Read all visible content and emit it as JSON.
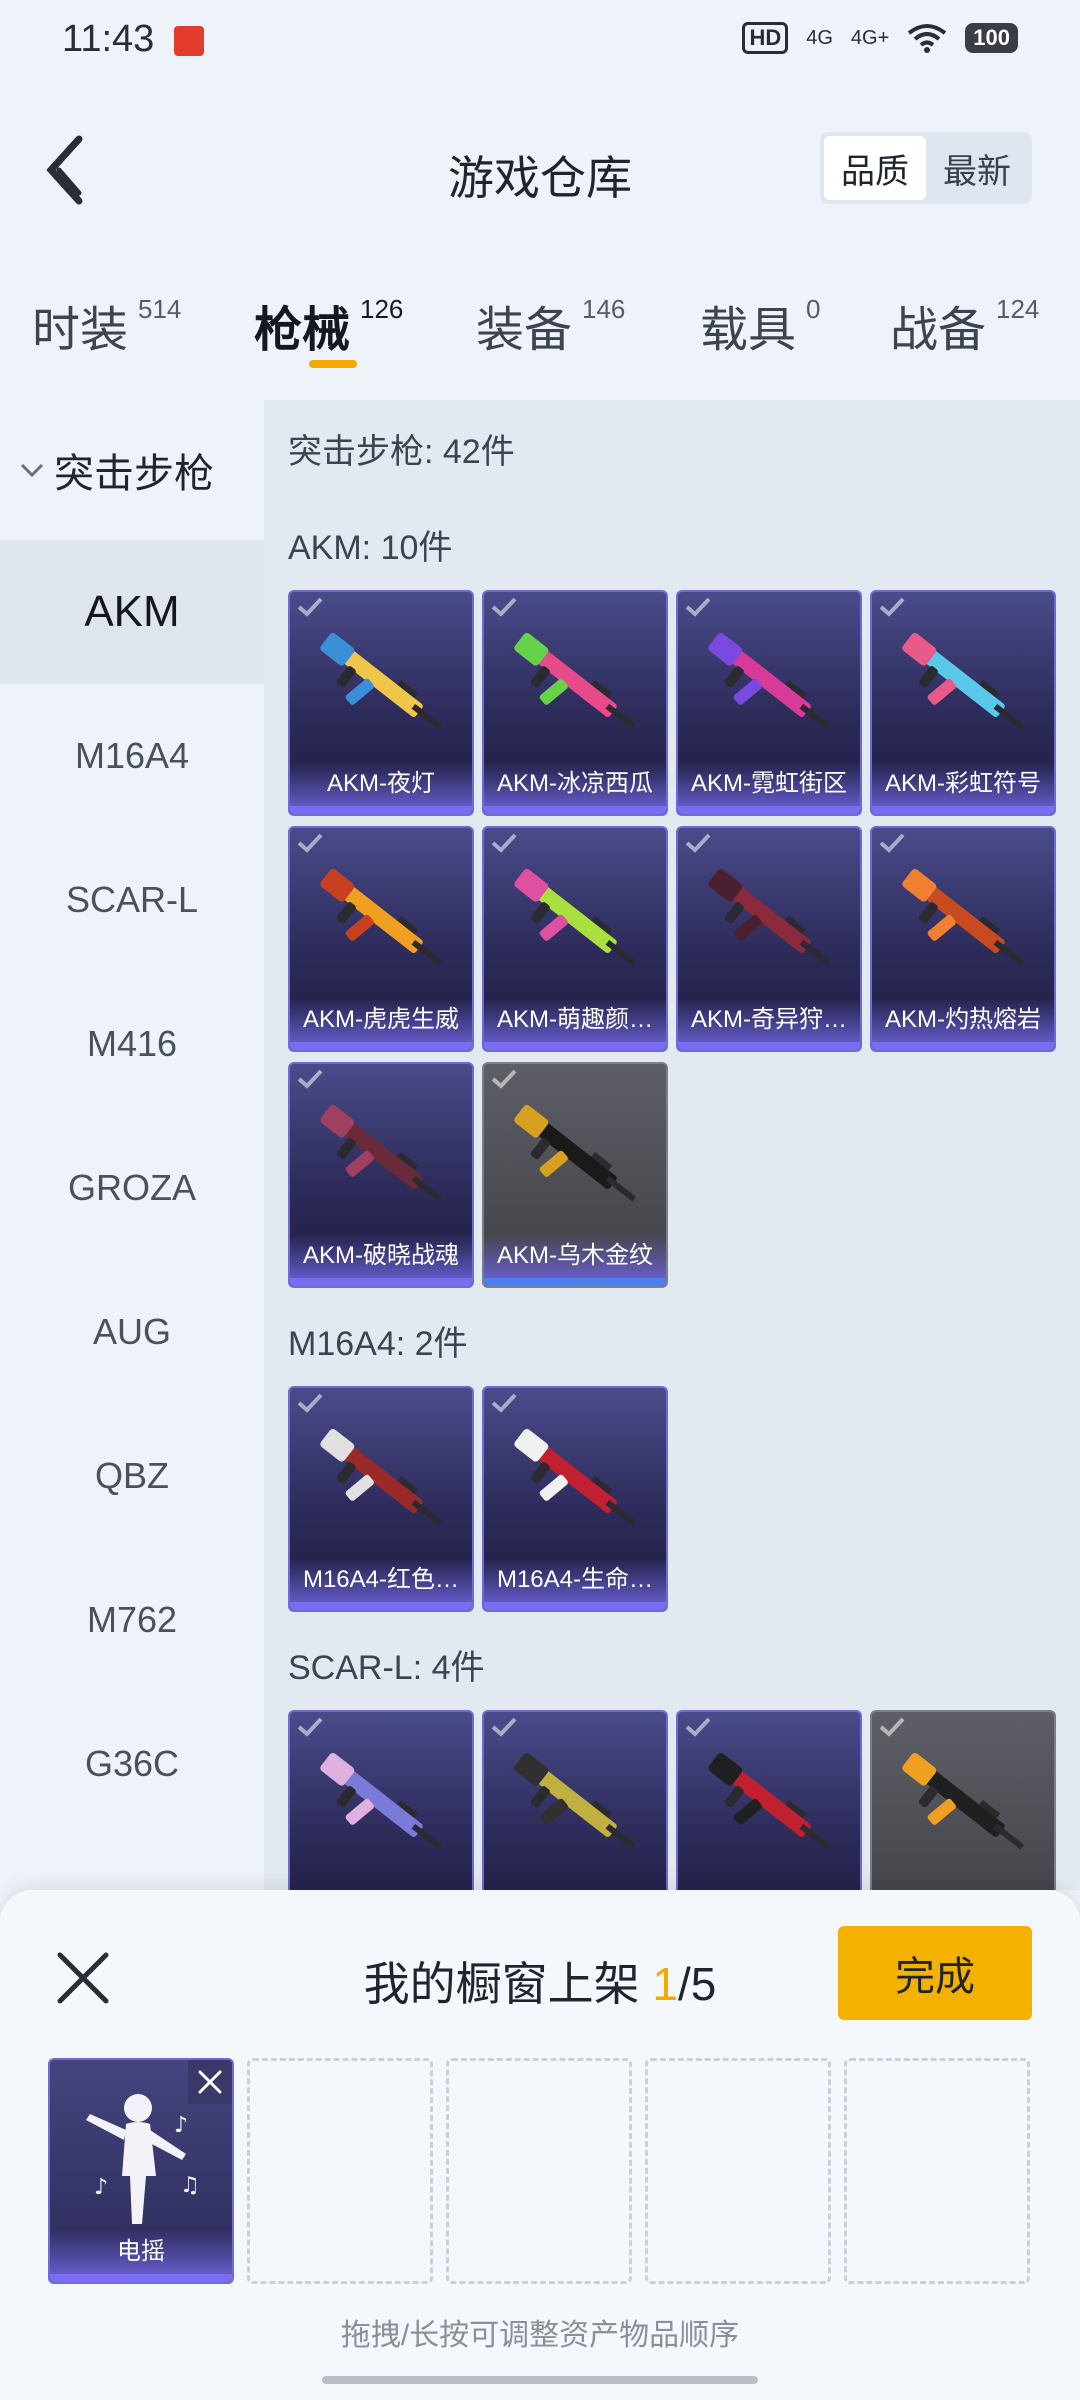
{
  "status_bar": {
    "time": "11:43",
    "network_1": "4G",
    "network_2": "4G+",
    "hd": "HD",
    "battery": "100"
  },
  "header": {
    "title": "游戏仓库",
    "sort_options": [
      "品质",
      "最新"
    ],
    "active_sort": "品质"
  },
  "tabs": [
    {
      "label": "时装",
      "count": "514"
    },
    {
      "label": "枪械",
      "count": "126",
      "active": true
    },
    {
      "label": "装备",
      "count": "146"
    },
    {
      "label": "载具",
      "count": "0"
    },
    {
      "label": "战备",
      "count": "124"
    }
  ],
  "sidebar": {
    "group": "突击步枪",
    "items": [
      "AKM",
      "M16A4",
      "SCAR-L",
      "M416",
      "GROZA",
      "AUG",
      "QBZ",
      "M762",
      "G36C"
    ],
    "active": "AKM"
  },
  "main": {
    "heading": "突击步枪: 42件",
    "sections": [
      {
        "title": "AKM: 10件",
        "items": [
          {
            "name": "AKM-夜灯",
            "rarity": "purple"
          },
          {
            "name": "AKM-冰凉西瓜",
            "rarity": "purple"
          },
          {
            "name": "AKM-霓虹街区",
            "rarity": "purple"
          },
          {
            "name": "AKM-彩虹符号",
            "rarity": "purple"
          },
          {
            "name": "AKM-虎虎生威",
            "rarity": "purple"
          },
          {
            "name": "AKM-萌趣颜…",
            "rarity": "purple"
          },
          {
            "name": "AKM-奇异狩…",
            "rarity": "purple"
          },
          {
            "name": "AKM-灼热熔岩",
            "rarity": "purple"
          },
          {
            "name": "AKM-破晓战魂",
            "rarity": "purple"
          },
          {
            "name": "AKM-乌木金纹",
            "rarity": "blue"
          }
        ]
      },
      {
        "title": "M16A4: 2件",
        "items": [
          {
            "name": "M16A4-红色…",
            "rarity": "purple"
          },
          {
            "name": "M16A4-生命…",
            "rarity": "purple"
          }
        ]
      },
      {
        "title": "SCAR-L: 4件",
        "items": [
          {
            "name": "",
            "rarity": "purple"
          },
          {
            "name": "",
            "rarity": "purple"
          },
          {
            "name": "",
            "rarity": "purple"
          },
          {
            "name": "",
            "rarity": "grey"
          }
        ]
      }
    ]
  },
  "sheet": {
    "title_prefix": "我的橱窗上架",
    "count_current": "1",
    "count_total": "/5",
    "done_label": "完成",
    "slot_item_name": "电摇",
    "hint": "拖拽/长按可调整资产物品顺序"
  },
  "colors": {
    "accent": "#f5a800",
    "purple_card": "#2d2b5a",
    "purple_bar": "#7b6cf0",
    "blue_bar": "#4b7ef0",
    "grey_card": "#4a4b52"
  }
}
